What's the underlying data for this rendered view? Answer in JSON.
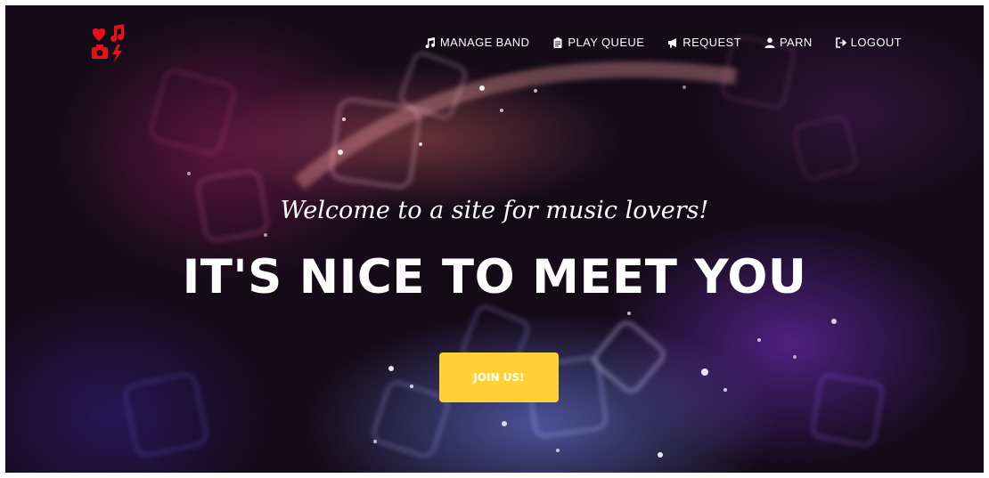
{
  "nav": {
    "items": [
      {
        "label": "MANAGE BAND",
        "icon": "music-note-icon"
      },
      {
        "label": "PLAY QUEUE",
        "icon": "clipboard-icon"
      },
      {
        "label": "REQUEST",
        "icon": "bullhorn-icon"
      },
      {
        "label": "PARN",
        "icon": "user-icon"
      },
      {
        "label": "LOGOUT",
        "icon": "sign-out-icon"
      }
    ]
  },
  "logo": {
    "icon": "band-logo-icon",
    "color": "#e8111b"
  },
  "hero": {
    "tagline": "Welcome to a site for music lovers!",
    "headline": "IT'S NICE TO MEET YOU",
    "button_label": "JOIN US!",
    "button_color": "#fed136"
  }
}
